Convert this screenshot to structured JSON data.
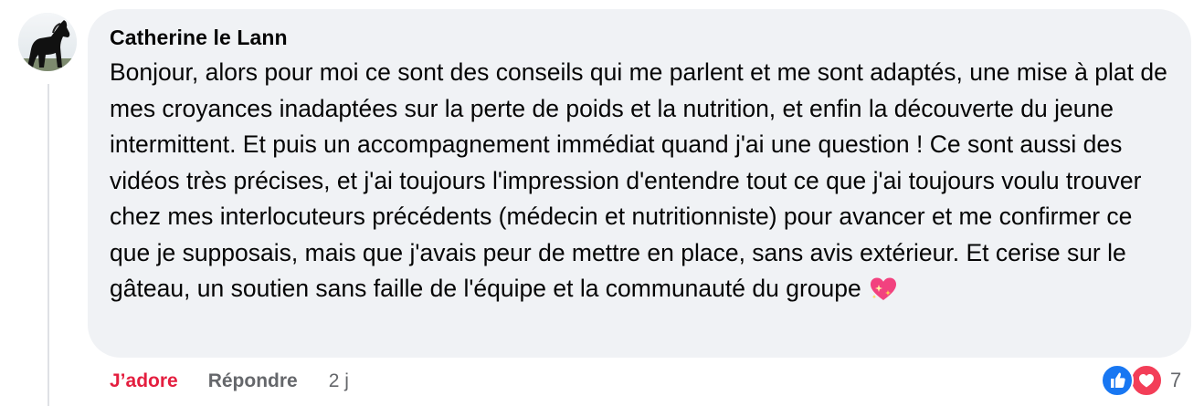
{
  "comment": {
    "author": "Catherine le Lann",
    "text": "Bonjour, alors pour moi ce sont des conseils qui me parlent et me sont adaptés, une mise à plat de mes croyances inadaptées sur la perte de poids et la nutrition, et enfin la découverte du jeune intermittent. Et puis un accompagnement immédiat quand j'ai une question ! Ce sont aussi des vidéos très précises, et j'ai toujours l'impression d'entendre tout ce que j'ai toujours voulu trouver chez mes interlocuteurs précédents (médecin et nutritionniste) pour avancer et me confirmer ce que je supposais, mais que j'avais peur de mettre en place, sans avis extérieur. Et cerise sur le gâteau, un soutien sans faille de l'équipe et la communauté du groupe",
    "emoji": "sparkling-heart-icon"
  },
  "actions": {
    "like_label": "J’adore",
    "reply_label": "Répondre",
    "time": "2 j"
  },
  "reactions": {
    "icons": [
      "like-icon",
      "love-icon"
    ],
    "count": "7"
  },
  "colors": {
    "bubble_bg": "#f0f2f5",
    "love_active": "#e41e3f",
    "secondary_text": "#65676b",
    "like_blue": "#1877f2",
    "love_red": "#f33e58"
  }
}
